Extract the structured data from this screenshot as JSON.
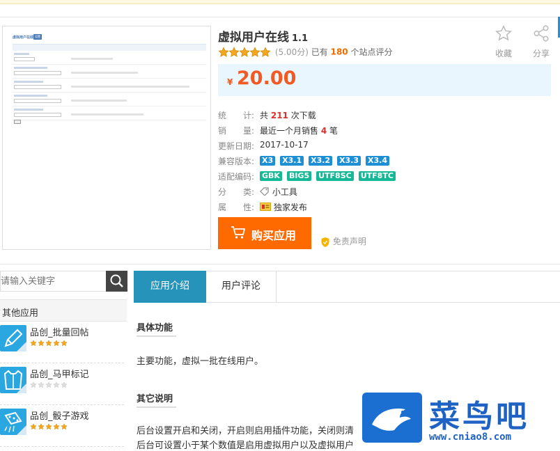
{
  "product": {
    "title": "虚拟用户在线",
    "version": "1.1",
    "rating_score": "(5.00分)",
    "rating_prefix": "已有",
    "rating_count": "180",
    "rating_suffix": "个站点评分",
    "stars": 5,
    "favorite_label": "收藏",
    "share_label": "分享",
    "currency": "¥",
    "price": "20.00",
    "stats": {
      "downloads_key": "统　　计:",
      "downloads_pre": "共",
      "downloads_num": "211",
      "downloads_post": "次下载",
      "sales_key": "销　　量:",
      "sales_pre": "最近一个月销售",
      "sales_num": "4",
      "sales_post": "笔",
      "updated_key": "更新日期:",
      "updated_val": "2017-10-17",
      "compat_key": "兼容版本:",
      "compat_versions": [
        "X3",
        "X3.1",
        "X3.2",
        "X3.3",
        "X3.4"
      ],
      "encoding_key": "适配编码:",
      "encodings": [
        "GBK",
        "BIG5",
        "UTF8SC",
        "UTF8TC"
      ],
      "category_key": "分　　类:",
      "category_val": "小工具",
      "attr_key": "属　　性:",
      "attr_val": "独家发布"
    },
    "buy_label": "购买应用",
    "disclaimer_label": "免责声明"
  },
  "sidebar": {
    "search_placeholder": "请输入关键字",
    "other_apps_title": "其他应用",
    "apps": [
      {
        "name": "品创_批量回帖",
        "stars": 5
      },
      {
        "name": "品创_马甲标记",
        "stars": 0
      },
      {
        "name": "品创_骰子游戏",
        "stars": 5
      }
    ]
  },
  "tabs": [
    {
      "label": "应用介绍",
      "active": true
    },
    {
      "label": "用户评论",
      "active": false
    }
  ],
  "content": {
    "sec1_title": "具体功能",
    "sec1_text": "主要功能，虚拟一批在线用户。",
    "sec2_title": "其它说明",
    "sec2_line1": "后台设置开启和关闭，开启则启用插件功能，关闭则清",
    "sec2_line2": "后台可设置小于某个数值是启用虚拟用户以及虚拟用户"
  },
  "watermark": {
    "brand_cn": "菜鸟吧",
    "url": "www.cniao8.com"
  },
  "colors": {
    "accent_blue": "#2693bb",
    "price_orange": "#f15a22",
    "buy_orange": "#ff6a00",
    "tag_blue": "#1c8fd5",
    "tag_green": "#15b894",
    "star_gold": "#f5a623"
  }
}
